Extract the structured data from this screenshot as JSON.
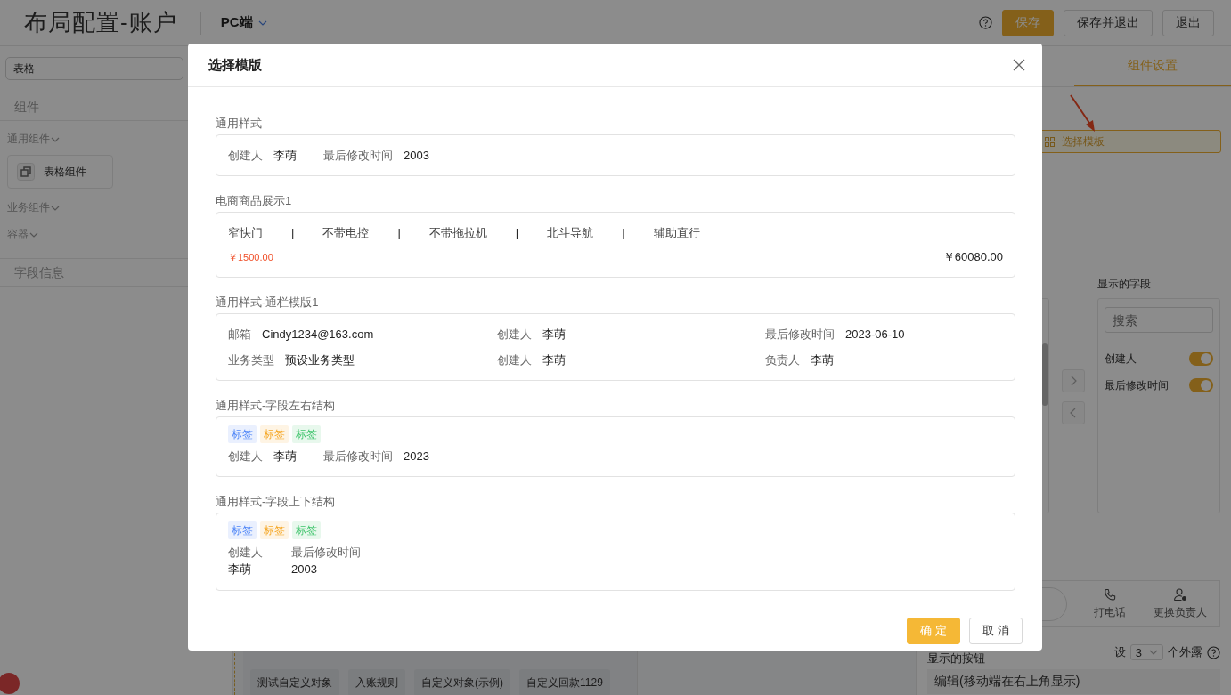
{
  "header": {
    "title": "布局配置-账户",
    "platform": "PC端",
    "buttons": [
      {
        "label": "保存",
        "kind": "primary"
      },
      {
        "label": "保存并退出",
        "kind": "default"
      },
      {
        "label": "退出",
        "kind": "default"
      }
    ]
  },
  "sidebar": {
    "search": {
      "value": "表格"
    },
    "items": [
      {
        "kind": "section",
        "label": "组件"
      },
      {
        "kind": "group",
        "label": "通用组件",
        "children": [
          {
            "label": "表格组件"
          }
        ]
      },
      {
        "kind": "group",
        "label": "业务组件"
      },
      {
        "kind": "group",
        "label": "容器"
      },
      {
        "kind": "section",
        "label": "字段信息"
      }
    ]
  },
  "canvas": {
    "chips": [
      "测试自定义对象",
      "入账规则",
      "自定义对象(示例)",
      "自定义回款1129"
    ]
  },
  "right_panel": {
    "tabs": [
      {
        "label": "组件设置",
        "selected": true
      }
    ],
    "template_button": "选择模板",
    "shown_fields": {
      "title": "显示的字段",
      "placeholder": "搜索",
      "items": [
        {
          "label": "创建人",
          "on": true
        },
        {
          "label": "最后修改时间",
          "on": true
        }
      ]
    },
    "actions": [
      {
        "kind": "call",
        "label": "打电话"
      },
      {
        "kind": "reassign",
        "label": "更换负责人"
      }
    ],
    "exposed": {
      "prefix": "设",
      "value": "3",
      "suffix": "个外露"
    },
    "buttons_title": "显示的按钮",
    "button_items": [
      "编辑(移动端在右上角显示)"
    ]
  },
  "modal": {
    "title": "选择模版",
    "templates": [
      {
        "title": "通用样式",
        "kind": "inline",
        "fields": [
          {
            "label": "创建人",
            "value": "李萌"
          },
          {
            "label": "最后修改时间",
            "value": "2003"
          }
        ]
      },
      {
        "title": "电商商品展示1",
        "kind": "product",
        "specs": [
          {
            "kind": "spec",
            "text": "窄快门"
          },
          {
            "kind": "separator",
            "text": "|"
          },
          {
            "kind": "spec",
            "text": "不带电控"
          },
          {
            "kind": "separator",
            "text": "|"
          },
          {
            "kind": "spec",
            "text": "不带拖拉机"
          },
          {
            "kind": "separator",
            "text": "|"
          },
          {
            "kind": "spec",
            "text": "北斗导航"
          },
          {
            "kind": "separator",
            "text": "|"
          },
          {
            "kind": "spec",
            "text": "辅助直行"
          }
        ],
        "price": "￥1500.00",
        "total": "￥60080.00"
      },
      {
        "title": "通用样式-通栏模版1",
        "kind": "grid",
        "fields": [
          {
            "label": "邮箱",
            "value": "Cindy1234@163.com"
          },
          {
            "label": "创建人",
            "value": "李萌"
          },
          {
            "label": "最后修改时间",
            "value": "2023-06-10"
          },
          {
            "label": "业务类型",
            "value": "预设业务类型"
          },
          {
            "label": "创建人",
            "value": "李萌"
          },
          {
            "label": "负责人",
            "value": "李萌"
          }
        ]
      },
      {
        "title": "通用样式-字段左右结构",
        "kind": "inline",
        "tags": [
          {
            "text": "标签",
            "color": "#4f86f7"
          },
          {
            "text": "标签",
            "color": "#f5a623"
          },
          {
            "text": "标签",
            "color": "#3fc46c"
          }
        ],
        "fields": [
          {
            "label": "创建人",
            "value": "李萌"
          },
          {
            "label": "最后修改时间",
            "value": "2023"
          }
        ]
      },
      {
        "title": "通用样式-字段上下结构",
        "kind": "stacked",
        "tags": [
          {
            "text": "标签",
            "color": "#4f86f7"
          },
          {
            "text": "标签",
            "color": "#f5a623"
          },
          {
            "text": "标签",
            "color": "#3fc46c"
          }
        ],
        "fields": [
          {
            "label": "创建人",
            "value": "李萌"
          },
          {
            "label": "最后修改时间",
            "value": "2003"
          }
        ]
      }
    ],
    "buttons": [
      {
        "label": "确 定",
        "kind": "primary"
      },
      {
        "label": "取 消",
        "kind": "default"
      }
    ]
  }
}
